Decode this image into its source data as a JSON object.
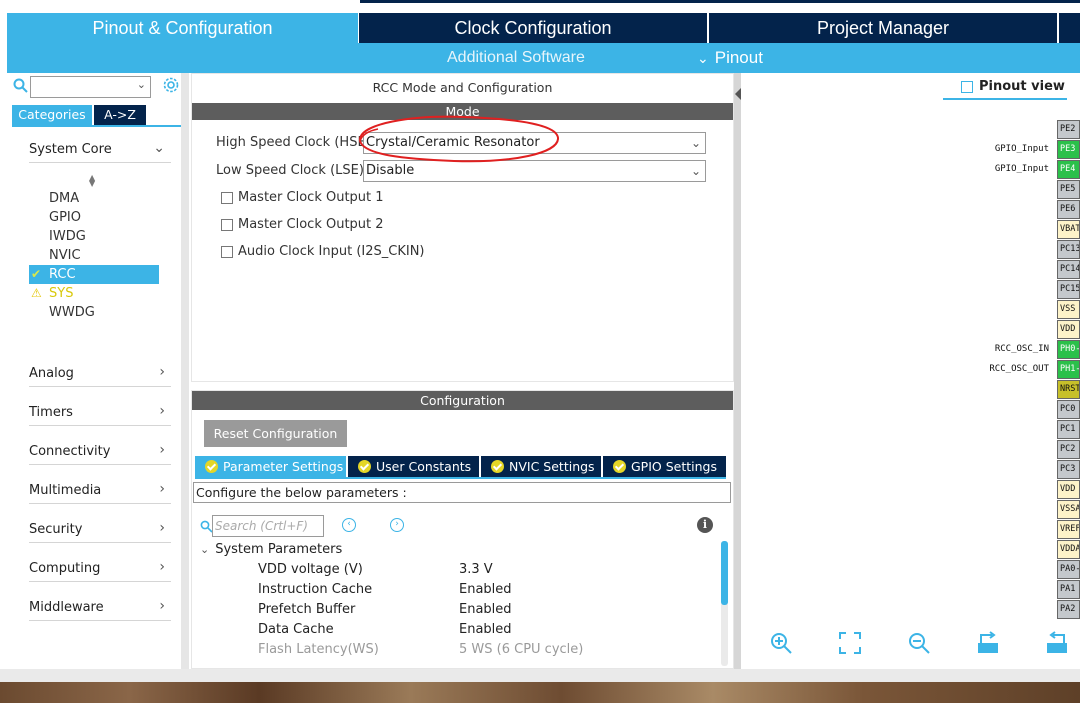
{
  "top_tabs": [
    {
      "label": "Pinout & Configuration",
      "active": true
    },
    {
      "label": "Clock Configuration",
      "active": false
    },
    {
      "label": "Project Manager",
      "active": false
    },
    {
      "label": "",
      "active": false
    }
  ],
  "subbar": {
    "additional_software": "Additional Software",
    "pinout": "Pinout"
  },
  "left": {
    "search_value": "",
    "category_tabs": [
      "Categories",
      "A->Z"
    ],
    "system_core": {
      "label": "System Core",
      "items": [
        "DMA",
        "GPIO",
        "IWDG",
        "NVIC",
        "RCC",
        "SYS",
        "WWDG"
      ],
      "selected": "RCC",
      "warning": "SYS"
    },
    "groups": [
      "Analog",
      "Timers",
      "Connectivity",
      "Multimedia",
      "Security",
      "Computing",
      "Middleware"
    ]
  },
  "mode_panel": {
    "title": "RCC Mode and Configuration",
    "section": "Mode",
    "hse_label": "High Speed Clock (HSE)",
    "hse_value": "Crystal/Ceramic Resonator",
    "lse_label": "Low Speed Clock (LSE)",
    "lse_value": "Disable",
    "checkboxes": [
      "Master Clock Output 1",
      "Master Clock Output 2",
      "Audio Clock Input (I2S_CKIN)"
    ]
  },
  "config_panel": {
    "section": "Configuration",
    "reset_label": "Reset Configuration",
    "tabs": [
      "Parameter Settings",
      "User Constants",
      "NVIC Settings",
      "GPIO Settings"
    ],
    "note": "Configure the below parameters :",
    "search_placeholder": "Search (Crtl+F)",
    "group_title": "System Parameters",
    "params": [
      {
        "name": "VDD voltage (V)",
        "value": "3.3 V",
        "dim": false
      },
      {
        "name": "Instruction Cache",
        "value": "Enabled",
        "dim": false
      },
      {
        "name": "Prefetch Buffer",
        "value": "Enabled",
        "dim": false
      },
      {
        "name": "Data Cache",
        "value": "Enabled",
        "dim": false
      },
      {
        "name": "Flash Latency(WS)",
        "value": "5 WS (6 CPU cycle)",
        "dim": true
      }
    ]
  },
  "pinout_view": {
    "title": "Pinout view",
    "pins": [
      {
        "name": "PE2",
        "color": "gray",
        "label": ""
      },
      {
        "name": "PE3",
        "color": "green",
        "label": "GPIO_Input"
      },
      {
        "name": "PE4",
        "color": "green",
        "label": "GPIO_Input"
      },
      {
        "name": "PE5",
        "color": "gray",
        "label": ""
      },
      {
        "name": "PE6",
        "color": "gray",
        "label": ""
      },
      {
        "name": "VBAT",
        "color": "cream",
        "label": ""
      },
      {
        "name": "PC13",
        "color": "gray",
        "label": ""
      },
      {
        "name": "PC14",
        "color": "gray",
        "label": ""
      },
      {
        "name": "PC15",
        "color": "gray",
        "label": ""
      },
      {
        "name": "VSS",
        "color": "cream",
        "label": ""
      },
      {
        "name": "VDD",
        "color": "cream",
        "label": ""
      },
      {
        "name": "PH0-",
        "color": "green",
        "label": "RCC_OSC_IN"
      },
      {
        "name": "PH1-",
        "color": "green",
        "label": "RCC_OSC_OUT"
      },
      {
        "name": "NRST",
        "color": "olive",
        "label": ""
      },
      {
        "name": "PC0",
        "color": "gray",
        "label": ""
      },
      {
        "name": "PC1",
        "color": "gray",
        "label": ""
      },
      {
        "name": "PC2",
        "color": "gray",
        "label": ""
      },
      {
        "name": "PC3",
        "color": "gray",
        "label": ""
      },
      {
        "name": "VDD",
        "color": "cream",
        "label": ""
      },
      {
        "name": "VSSA",
        "color": "cream",
        "label": ""
      },
      {
        "name": "VREF",
        "color": "cream",
        "label": ""
      },
      {
        "name": "VDDA",
        "color": "cream",
        "label": ""
      },
      {
        "name": "PA0-",
        "color": "gray",
        "label": ""
      },
      {
        "name": "PA1",
        "color": "gray",
        "label": ""
      },
      {
        "name": "PA2",
        "color": "gray",
        "label": ""
      }
    ]
  },
  "colors": {
    "accent": "#3cb4e6",
    "navy": "#03234b",
    "pin_green": "#2bc04a",
    "annotation_red": "#e02020"
  }
}
